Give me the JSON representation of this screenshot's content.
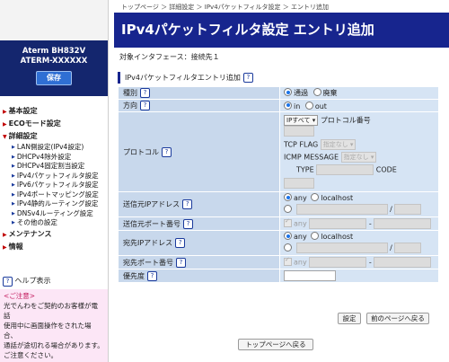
{
  "device": {
    "model": "Aterm   BH832V",
    "name": "ATERM-XXXXXX",
    "save_label": "保存"
  },
  "menu": {
    "basic": "基本設定",
    "eco": "ECOモード設定",
    "advanced": "詳細設定",
    "advanced_items": [
      "LAN側設定(IPv4設定)",
      "DHCPv4除外設定",
      "DHCPv4固定割当設定",
      "IPv4パケットフィルタ設定",
      "IPv6パケットフィルタ設定",
      "IPv4ポートマッピング設定",
      "IPv4静的ルーティング設定",
      "DNSv4ルーティング設定",
      "その他の設定"
    ],
    "maintenance": "メンテナンス",
    "info": "情報"
  },
  "help": {
    "label": "ヘルプ表示",
    "q": "?"
  },
  "notice": {
    "title": "<ご注意>",
    "lines": [
      "光でんわをご契約のお客様が電話",
      "使用中に画面操作をされた場合、",
      "通話が途切れる場合があります。",
      "ご注意ください。"
    ]
  },
  "breadcrumb": "トップページ ＞ 詳細設定 ＞ IPv4パケットフィルタ設定 ＞ エントリ追加",
  "page_title": "IPv4パケットフィルタ設定 エントリ追加",
  "interface_line": "対象インタフェース：接続先１",
  "section_title": "IPv4パケットフィルタエントリ追加",
  "rows": {
    "type": {
      "label": "種別",
      "options": [
        "通過",
        "廃棄"
      ]
    },
    "direction": {
      "label": "方向",
      "options": [
        "in",
        "out"
      ]
    },
    "protocol": {
      "label": "プロトコル",
      "select": "IPすべて",
      "number_label": "プロトコル番号",
      "tcp_flag_label": "TCP FLAG",
      "tcp_flag_value": "指定なし",
      "icmp_label": "ICMP MESSAGE",
      "icmp_value": "指定なし",
      "type_label": "TYPE",
      "code_label": "CODE"
    },
    "src_ip": {
      "label": "送信元IPアドレス",
      "options": [
        "any",
        "localhost"
      ],
      "slash": "/"
    },
    "src_port": {
      "label": "送信元ポート番号",
      "any": "any",
      "dash": "-"
    },
    "dst_ip": {
      "label": "宛先IPアドレス",
      "options": [
        "any",
        "localhost"
      ],
      "slash": "/"
    },
    "dst_port": {
      "label": "宛先ポート番号",
      "any": "any",
      "dash": "-"
    },
    "priority": {
      "label": "優先度"
    }
  },
  "buttons": {
    "set": "設定",
    "back": "前のページへ戻る",
    "top": "トップページへ戻る"
  },
  "colors": {
    "title_bar": "#17258e",
    "device_panel": "#14266e",
    "label_cell": "#c8d8ec",
    "value_cell": "#d6e4f4",
    "notice_bg": "#fce6f6"
  }
}
